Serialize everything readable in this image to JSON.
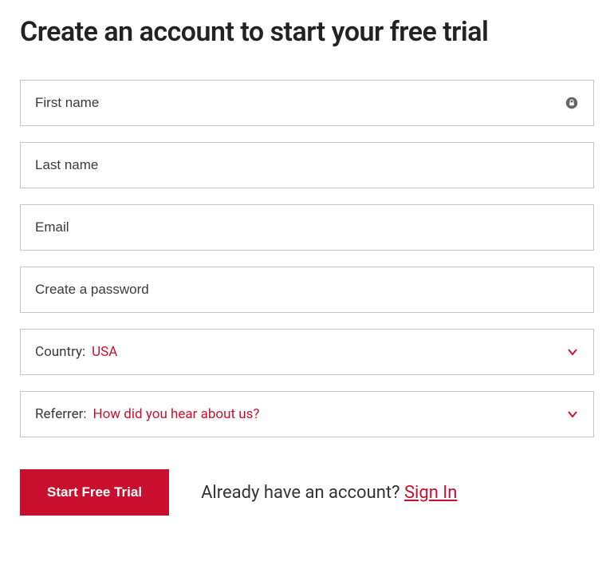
{
  "heading": "Create an account to start your free trial",
  "fields": {
    "first_name_placeholder": "First name",
    "last_name_placeholder": "Last name",
    "email_placeholder": "Email",
    "password_placeholder": "Create a password"
  },
  "country": {
    "label": "Country:",
    "value": "USA"
  },
  "referrer": {
    "label": "Referrer:",
    "value": "How did you hear about us?"
  },
  "actions": {
    "submit_label": "Start Free Trial",
    "prompt_text": "Already have an account? ",
    "signin_label": "Sign In"
  }
}
